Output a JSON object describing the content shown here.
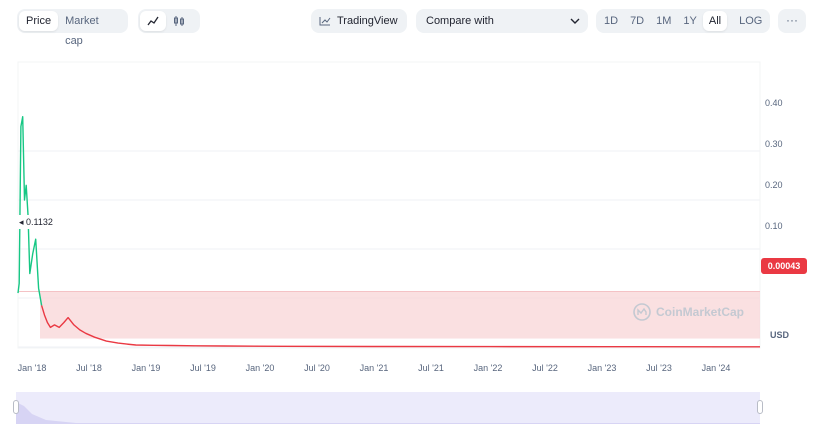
{
  "toolbar": {
    "view_tabs": [
      {
        "label": "Price",
        "active": true
      },
      {
        "label": "Market cap",
        "active": false
      }
    ],
    "chart_style": {
      "line_icon": "line-chart-icon",
      "candle_icon": "candlestick-icon",
      "active": "line"
    },
    "tradingview_label": "TradingView",
    "compare_placeholder": "Compare with",
    "ranges": [
      {
        "label": "1D",
        "active": false
      },
      {
        "label": "7D",
        "active": false
      },
      {
        "label": "1M",
        "active": false
      },
      {
        "label": "1Y",
        "active": false
      },
      {
        "label": "All",
        "active": true
      }
    ],
    "log_label": "LOG",
    "more_label": "···"
  },
  "chart": {
    "start_label": "0.1132",
    "current_price_label": "0.00043",
    "currency_label": "USD",
    "watermark": "CoinMarketCap",
    "colors": {
      "up": "#16c784",
      "down": "#ea3943",
      "fill_down": "#f8d5d7",
      "navigator": "#ecebfb"
    }
  },
  "chart_data": {
    "type": "line",
    "ylabel": "USD",
    "yticks": [
      "0.10",
      "0.20",
      "0.30",
      "0.40"
    ],
    "ylim": [
      0,
      0.5
    ],
    "xticks": [
      "Jan '18",
      "Jul '18",
      "Jan '19",
      "Jul '19",
      "Jan '20",
      "Jul '20",
      "Jan '21",
      "Jul '21",
      "Jan '22",
      "Jul '22",
      "Jan '23",
      "Jul '23",
      "Jan '24"
    ],
    "baseline": 0.1132,
    "latest": 0.00043,
    "series": [
      {
        "x": [
          0,
          0.02,
          0.05,
          0.08,
          0.11,
          0.14,
          0.17,
          0.2,
          0.25,
          0.3,
          0.35,
          0.4,
          0.45,
          0.5,
          0.55,
          0.62,
          0.7,
          0.78,
          0.85,
          0.95,
          1.05,
          1.15,
          1.3,
          1.5,
          1.7,
          1.85,
          2.0,
          2.3,
          2.6,
          3.0,
          3.5,
          4.5,
          6,
          8,
          10,
          12,
          12.6
        ],
        "y": [
          0.11,
          0.13,
          0.45,
          0.47,
          0.3,
          0.33,
          0.27,
          0.15,
          0.19,
          0.22,
          0.12,
          0.085,
          0.065,
          0.05,
          0.04,
          0.045,
          0.04,
          0.05,
          0.06,
          0.045,
          0.035,
          0.028,
          0.02,
          0.012,
          0.008,
          0.006,
          0.004,
          0.0035,
          0.003,
          0.0025,
          0.002,
          0.0015,
          0.001,
          0.0008,
          0.0006,
          0.0005,
          0.00043
        ]
      }
    ]
  }
}
